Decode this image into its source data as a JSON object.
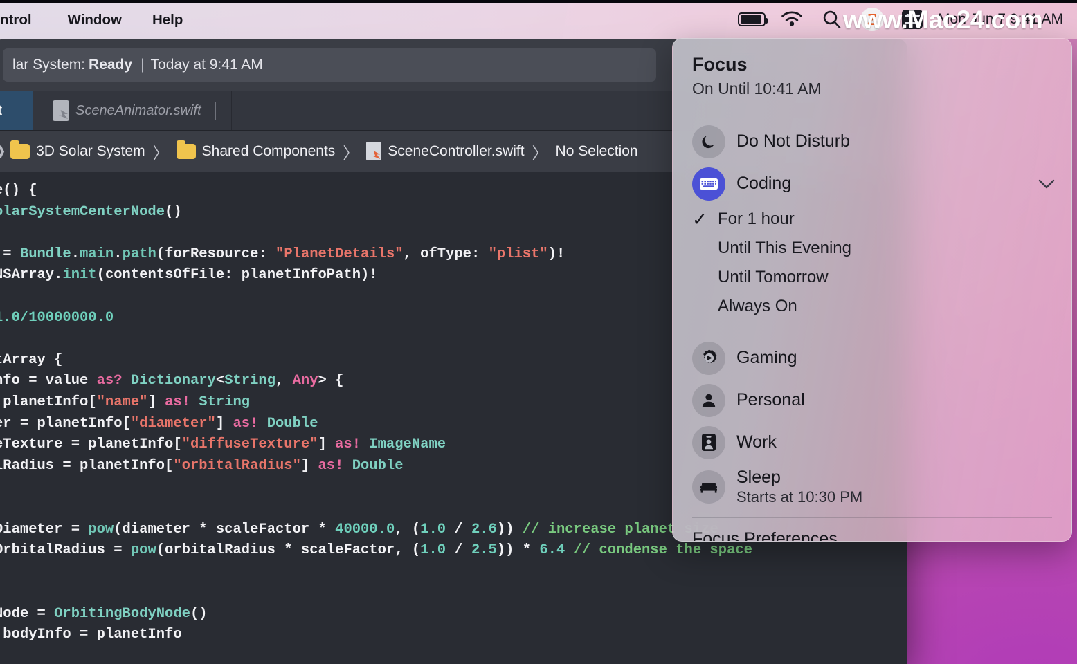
{
  "menubar": {
    "items": [
      {
        "label": "ntrol",
        "name": "menu-control"
      },
      {
        "label": "Window",
        "name": "menu-window"
      },
      {
        "label": "Help",
        "name": "menu-help"
      }
    ],
    "icons": {
      "battery": "battery-icon",
      "wifi": "wifi-icon",
      "search": "search-icon",
      "zoom": "zoom-app-icon",
      "control_center": "control-center-icon"
    },
    "clock": "Mon Jun 7  9:41 AM"
  },
  "watermark": {
    "text": "www.Mac24.com"
  },
  "xcode": {
    "status": {
      "prefix": "lar System:",
      "state": "Ready",
      "separator": "|",
      "detail": "Today at 9:41 AM"
    },
    "tabs": [
      {
        "label": "ft",
        "active": true
      },
      {
        "label": "SceneAnimator.swift",
        "active": false
      }
    ],
    "breadcrumb": {
      "items": [
        "3D Solar System",
        "Shared Components",
        "SceneController.swift",
        "No Selection"
      ],
      "separator": "〉"
    },
    "code_lines": [
      [
        {
          "t": "e() {",
          "c": "k-plain"
        }
      ],
      [
        {
          "t": "olarSystemCenterNode",
          "c": "k-type"
        },
        {
          "t": "()",
          "c": "k-plain"
        }
      ],
      [
        {
          "t": "",
          "c": "k-plain"
        }
      ],
      [
        {
          "t": " = ",
          "c": "k-plain"
        },
        {
          "t": "Bundle",
          "c": "k-type"
        },
        {
          "t": ".",
          "c": "k-plain"
        },
        {
          "t": "main",
          "c": "k-fn"
        },
        {
          "t": ".",
          "c": "k-plain"
        },
        {
          "t": "path",
          "c": "k-fn"
        },
        {
          "t": "(forResource: ",
          "c": "k-plain"
        },
        {
          "t": "\"PlanetDetails\"",
          "c": "k-str"
        },
        {
          "t": ", ofType: ",
          "c": "k-plain"
        },
        {
          "t": "\"plist\"",
          "c": "k-str"
        },
        {
          "t": ")!",
          "c": "k-plain"
        }
      ],
      [
        {
          "t": "NSArray",
          "c": "k-plain"
        },
        {
          "t": ".",
          "c": "k-plain"
        },
        {
          "t": "init",
          "c": "k-fn"
        },
        {
          "t": "(contentsOfFile: planetInfoPath)!",
          "c": "k-plain"
        }
      ],
      [
        {
          "t": "",
          "c": "k-plain"
        }
      ],
      [
        {
          "t": "1.0/10000000.0",
          "c": "k-num"
        }
      ],
      [
        {
          "t": "",
          "c": "k-plain"
        }
      ],
      [
        {
          "t": "tArray {",
          "c": "k-plain"
        }
      ],
      [
        {
          "t": "nfo = value ",
          "c": "k-plain"
        },
        {
          "t": "as?",
          "c": "k-kw"
        },
        {
          "t": " ",
          "c": "k-plain"
        },
        {
          "t": "Dictionary",
          "c": "k-type"
        },
        {
          "t": "<",
          "c": "k-plain"
        },
        {
          "t": "String",
          "c": "k-type"
        },
        {
          "t": ", ",
          "c": "k-plain"
        },
        {
          "t": "Any",
          "c": "k-kw"
        },
        {
          "t": "> {",
          "c": "k-plain"
        }
      ],
      [
        {
          "t": " planetInfo[",
          "c": "k-plain"
        },
        {
          "t": "\"name\"",
          "c": "k-str"
        },
        {
          "t": "] ",
          "c": "k-plain"
        },
        {
          "t": "as!",
          "c": "k-kw"
        },
        {
          "t": " ",
          "c": "k-plain"
        },
        {
          "t": "String",
          "c": "k-type"
        }
      ],
      [
        {
          "t": "er = planetInfo[",
          "c": "k-plain"
        },
        {
          "t": "\"diameter\"",
          "c": "k-str"
        },
        {
          "t": "] ",
          "c": "k-plain"
        },
        {
          "t": "as!",
          "c": "k-kw"
        },
        {
          "t": " ",
          "c": "k-plain"
        },
        {
          "t": "Double",
          "c": "k-type"
        }
      ],
      [
        {
          "t": "eTexture = planetInfo[",
          "c": "k-plain"
        },
        {
          "t": "\"diffuseTexture\"",
          "c": "k-str"
        },
        {
          "t": "] ",
          "c": "k-plain"
        },
        {
          "t": "as!",
          "c": "k-kw"
        },
        {
          "t": " ",
          "c": "k-plain"
        },
        {
          "t": "ImageName",
          "c": "k-type"
        }
      ],
      [
        {
          "t": "lRadius = planetInfo[",
          "c": "k-plain"
        },
        {
          "t": "\"orbitalRadius\"",
          "c": "k-str"
        },
        {
          "t": "] ",
          "c": "k-plain"
        },
        {
          "t": "as!",
          "c": "k-kw"
        },
        {
          "t": " ",
          "c": "k-plain"
        },
        {
          "t": "Double",
          "c": "k-type"
        }
      ],
      [
        {
          "t": "",
          "c": "k-plain"
        }
      ],
      [
        {
          "t": "",
          "c": "k-plain"
        }
      ],
      [
        {
          "t": "Diameter = ",
          "c": "k-plain"
        },
        {
          "t": "pow",
          "c": "k-fn"
        },
        {
          "t": "(diameter ",
          "c": "k-plain"
        },
        {
          "t": "*",
          "c": "k-plain"
        },
        {
          "t": " scaleFactor ",
          "c": "k-plain"
        },
        {
          "t": "*",
          "c": "k-plain"
        },
        {
          "t": " ",
          "c": "k-plain"
        },
        {
          "t": "40000.0",
          "c": "k-num"
        },
        {
          "t": ", (",
          "c": "k-plain"
        },
        {
          "t": "1.0",
          "c": "k-num"
        },
        {
          "t": " / ",
          "c": "k-plain"
        },
        {
          "t": "2.6",
          "c": "k-num"
        },
        {
          "t": ")) ",
          "c": "k-plain"
        },
        {
          "t": "// increase planet size",
          "c": "k-com"
        }
      ],
      [
        {
          "t": "OrbitalRadius = ",
          "c": "k-plain"
        },
        {
          "t": "pow",
          "c": "k-fn"
        },
        {
          "t": "(orbitalRadius ",
          "c": "k-plain"
        },
        {
          "t": "*",
          "c": "k-plain"
        },
        {
          "t": " scaleFactor, (",
          "c": "k-plain"
        },
        {
          "t": "1.0",
          "c": "k-num"
        },
        {
          "t": " / ",
          "c": "k-plain"
        },
        {
          "t": "2.5",
          "c": "k-num"
        },
        {
          "t": ")) ",
          "c": "k-plain"
        },
        {
          "t": "*",
          "c": "k-plain"
        },
        {
          "t": " ",
          "c": "k-plain"
        },
        {
          "t": "6.4",
          "c": "k-num"
        },
        {
          "t": " ",
          "c": "k-plain"
        },
        {
          "t": "// condense the space",
          "c": "k-com"
        }
      ],
      [
        {
          "t": "",
          "c": "k-plain"
        }
      ],
      [
        {
          "t": "",
          "c": "k-plain"
        }
      ],
      [
        {
          "t": "Node = ",
          "c": "k-plain"
        },
        {
          "t": "OrbitingBodyNode",
          "c": "k-type"
        },
        {
          "t": "()",
          "c": "k-plain"
        }
      ],
      [
        {
          "t": " bodyInfo = planetInfo",
          "c": "k-plain"
        }
      ]
    ]
  },
  "focus": {
    "title": "Focus",
    "subtitle": "On Until 10:41 AM",
    "dnd": {
      "label": "Do Not Disturb",
      "icon": "moon-icon"
    },
    "coding": {
      "label": "Coding",
      "icon": "keyboard-icon",
      "chevron": "⌄",
      "color": "#4b51d6"
    },
    "duration_options": [
      {
        "label": "For 1 hour",
        "checked": true
      },
      {
        "label": "Until This Evening",
        "checked": false
      },
      {
        "label": "Until Tomorrow",
        "checked": false
      },
      {
        "label": "Always On",
        "checked": false
      }
    ],
    "check_glyph": "✓",
    "modes": [
      {
        "label": "Gaming",
        "icon": "gaming-icon",
        "sublabel": ""
      },
      {
        "label": "Personal",
        "icon": "person-icon",
        "sublabel": ""
      },
      {
        "label": "Work",
        "icon": "badge-icon",
        "sublabel": ""
      },
      {
        "label": "Sleep",
        "icon": "bed-icon",
        "sublabel": "Starts at 10:30 PM"
      }
    ],
    "preferences": "Focus Preferences..."
  }
}
